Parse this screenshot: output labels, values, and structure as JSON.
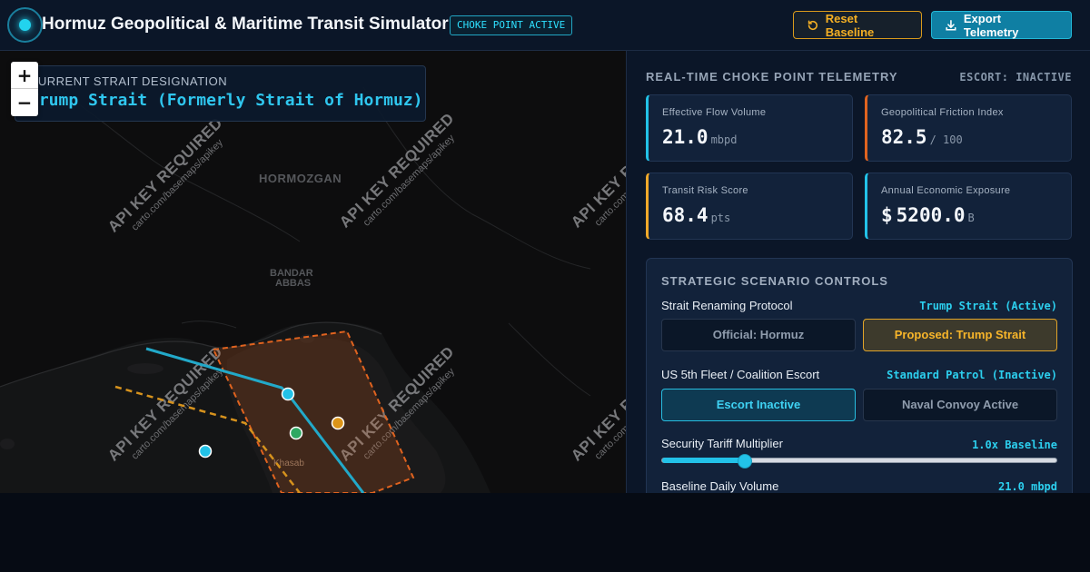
{
  "header": {
    "title": "Hormuz Geopolitical & Maritime Transit Simulator",
    "badge": "CHOKE POINT ACTIVE",
    "reset_label": "Reset Baseline",
    "export_label": "Export Telemetry"
  },
  "map": {
    "designation_label": "CURRENT STRAIT DESIGNATION",
    "designation_value": "Trump Strait (Formerly Strait of Hormuz)",
    "zoom_in": "+",
    "zoom_out": "−",
    "place_labels": [
      "HORMOZGAN",
      "BANDAR",
      "ABBAS",
      "Khasab"
    ],
    "watermark_title": "API KEY REQUIRED",
    "watermark_sub": "carto.com/basemaps/apikey",
    "colors": {
      "route_primary": "#22a9c9",
      "route_alt": "#d6921d",
      "zone": "#e0631f",
      "marker_ok": "#2ea862",
      "marker_warn": "#dc9418",
      "marker_info": "#22c2e8"
    }
  },
  "panel": {
    "title": "REAL-TIME CHOKE POINT TELEMETRY",
    "escort_status": "ESCORT: INACTIVE",
    "metrics": [
      {
        "label": "Effective Flow Volume",
        "prefix": "",
        "value": "21.0",
        "unit": "mbpd",
        "accent": "#22c2e8"
      },
      {
        "label": "Geopolitical Friction Index",
        "prefix": "",
        "value": "82.5",
        "unit": "/ 100",
        "accent": "#e0631f"
      },
      {
        "label": "Transit Risk Score",
        "prefix": "",
        "value": "68.4",
        "unit": "pts",
        "accent": "#f0a92a"
      },
      {
        "label": "Annual Economic Exposure",
        "prefix": "$",
        "value": "5200.0",
        "unit": "B",
        "accent": "#22c2e8"
      }
    ],
    "controls": {
      "title": "STRATEGIC SCENARIO CONTROLS",
      "renaming": {
        "label": "Strait Renaming Protocol",
        "value": "Trump Strait (Active)",
        "options": [
          "Official: Hormuz",
          "Proposed: Trump Strait"
        ]
      },
      "escort": {
        "label": "US 5th Fleet / Coalition Escort",
        "value": "Standard Patrol (Inactive)",
        "options": [
          "Escort Inactive",
          "Naval Convoy Active"
        ]
      },
      "tariff": {
        "label": "Security Tariff Multiplier",
        "value": "1.0x Baseline",
        "level": 0.21
      },
      "volume": {
        "label": "Baseline Daily Volume",
        "value": "21.0 mbpd"
      }
    }
  }
}
